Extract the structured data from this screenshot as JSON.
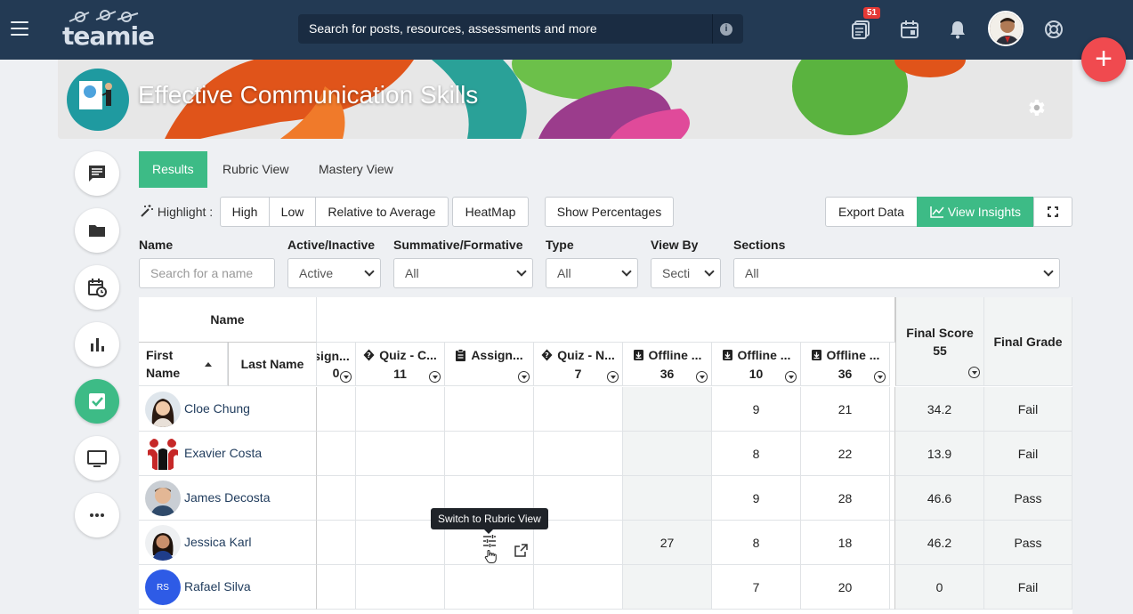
{
  "header": {
    "logo_text": "teamie",
    "search_placeholder": "Search for posts, resources, assessments and more",
    "notif_badge": "51"
  },
  "course": {
    "title": "Effective Communication Skills"
  },
  "tabs": [
    {
      "label": "Results"
    },
    {
      "label": "Rubric View"
    },
    {
      "label": "Mastery View"
    }
  ],
  "toolbar": {
    "highlight_label": "Highlight :",
    "high": "High",
    "low": "Low",
    "relative": "Relative to Average",
    "heatmap": "HeatMap",
    "show_percentages": "Show Percentages",
    "export": "Export Data",
    "insights": "View Insights"
  },
  "filters": {
    "name_label": "Name",
    "name_placeholder": "Search for a name",
    "active_label": "Active/Inactive",
    "active_value": "Active",
    "summative_label": "Summative/Formative",
    "summative_value": "All",
    "type_label": "Type",
    "type_value": "All",
    "viewby_label": "View By",
    "viewby_value": "Secti",
    "sections_label": "Sections",
    "sections_value": "All"
  },
  "table": {
    "name_header": "Name",
    "first_name": "First Name",
    "last_name": "Last Name",
    "columns": [
      {
        "title": "Assign...",
        "marks": "0",
        "icon": "assignment-icon",
        "display": "sign..."
      },
      {
        "title": "Quiz - C...",
        "marks": "11",
        "icon": "quiz-icon"
      },
      {
        "title": "Assign...",
        "marks": "",
        "icon": "assignment-icon"
      },
      {
        "title": "Quiz - N...",
        "marks": "7",
        "icon": "quiz-icon"
      },
      {
        "title": "Offline ...",
        "marks": "36",
        "icon": "offline-icon"
      },
      {
        "title": "Offline ...",
        "marks": "10",
        "icon": "offline-icon"
      },
      {
        "title": "Offline ...",
        "marks": "36",
        "icon": "offline-icon"
      }
    ],
    "final_score_label": "Final Score",
    "final_score_max": "55",
    "final_grade_label": "Final Grade",
    "rows": [
      {
        "name": "Cloe Chung",
        "avatar": "photo",
        "c": [
          "",
          "",
          "",
          "",
          "",
          "9",
          "21"
        ],
        "score": "34.2",
        "grade": "Fail"
      },
      {
        "name": "Exavier Costa",
        "avatar": "logo",
        "c": [
          "",
          "",
          "",
          "",
          "",
          "8",
          "22"
        ],
        "score": "13.9",
        "grade": "Fail"
      },
      {
        "name": "James Decosta",
        "avatar": "photo",
        "c": [
          "",
          "",
          "",
          "",
          "",
          "9",
          "28"
        ],
        "score": "46.6",
        "grade": "Pass"
      },
      {
        "name": "Jessica Karl",
        "avatar": "photo",
        "c": [
          "",
          "",
          "",
          "",
          "27",
          "8",
          "18"
        ],
        "score": "46.2",
        "grade": "Pass"
      },
      {
        "name": "Rafael Silva",
        "avatar": "RS",
        "c": [
          "",
          "",
          "",
          "",
          "",
          "7",
          "20"
        ],
        "score": "0",
        "grade": "Fail"
      }
    ]
  },
  "tooltip": "Switch to Rubric View",
  "colors": {
    "accent": "#3dbb86",
    "topbar": "#233a54",
    "fab": "#f04a4f"
  }
}
